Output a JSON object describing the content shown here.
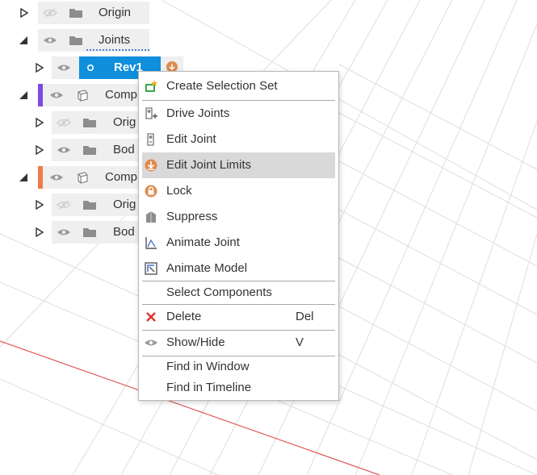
{
  "browser": {
    "rows": [
      {
        "label": "Origin",
        "eye": "eye-hidden-icon",
        "icon": "folder-icon",
        "expanded": false
      },
      {
        "label": "Joints",
        "eye": "eye-visible-icon",
        "icon": "folder-icon",
        "expanded": true
      },
      {
        "label": "Rev1",
        "eye": "eye-visible-icon",
        "icon": "revolute-joint-icon",
        "expanded": false,
        "selected": true
      },
      {
        "label": "Comp",
        "eye": "eye-visible-icon",
        "icon": "component-icon",
        "expanded": true,
        "color": "#7a4be0"
      },
      {
        "label": "Orig",
        "eye": "eye-hidden-icon",
        "icon": "folder-icon",
        "expanded": false
      },
      {
        "label": "Bod",
        "eye": "eye-visible-icon",
        "icon": "folder-icon",
        "expanded": false
      },
      {
        "label": "Comp",
        "eye": "eye-visible-icon",
        "icon": "component-icon",
        "expanded": true,
        "color": "#f07a4a"
      },
      {
        "label": "Orig",
        "eye": "eye-hidden-icon",
        "icon": "folder-icon",
        "expanded": false
      },
      {
        "label": "Bod",
        "eye": "eye-visible-icon",
        "icon": "folder-icon",
        "expanded": false
      }
    ],
    "joint_limit_badge_icon": "joint-limits-icon"
  },
  "context_menu": {
    "items": [
      {
        "label": "Create Selection Set",
        "icon": "selection-set-icon",
        "shortcut": ""
      },
      {
        "label": "Drive Joints",
        "icon": "drive-joints-icon",
        "shortcut": ""
      },
      {
        "label": "Edit Joint",
        "icon": "edit-joint-icon",
        "shortcut": ""
      },
      {
        "label": "Edit Joint Limits",
        "icon": "joint-limits-icon",
        "shortcut": "",
        "highlighted": true
      },
      {
        "label": "Lock",
        "icon": "lock-icon",
        "shortcut": ""
      },
      {
        "label": "Suppress",
        "icon": "suppress-icon",
        "shortcut": ""
      },
      {
        "label": "Animate Joint",
        "icon": "animate-joint-icon",
        "shortcut": ""
      },
      {
        "label": "Animate Model",
        "icon": "animate-model-icon",
        "shortcut": ""
      },
      {
        "label": "Select Components",
        "icon": "",
        "shortcut": ""
      },
      {
        "label": "Delete",
        "icon": "delete-icon",
        "shortcut": "Del"
      },
      {
        "label": "Show/Hide",
        "icon": "eye-visible-icon",
        "shortcut": "V"
      },
      {
        "label": "Find in Window",
        "icon": "",
        "shortcut": ""
      },
      {
        "label": "Find in Timeline",
        "icon": "",
        "shortcut": ""
      }
    ]
  },
  "colors": {
    "selection": "#0f8fdc",
    "highlight": "#d9d9d9",
    "grid_line": "#d6d6d6",
    "axis_red": "#e05a5a"
  }
}
